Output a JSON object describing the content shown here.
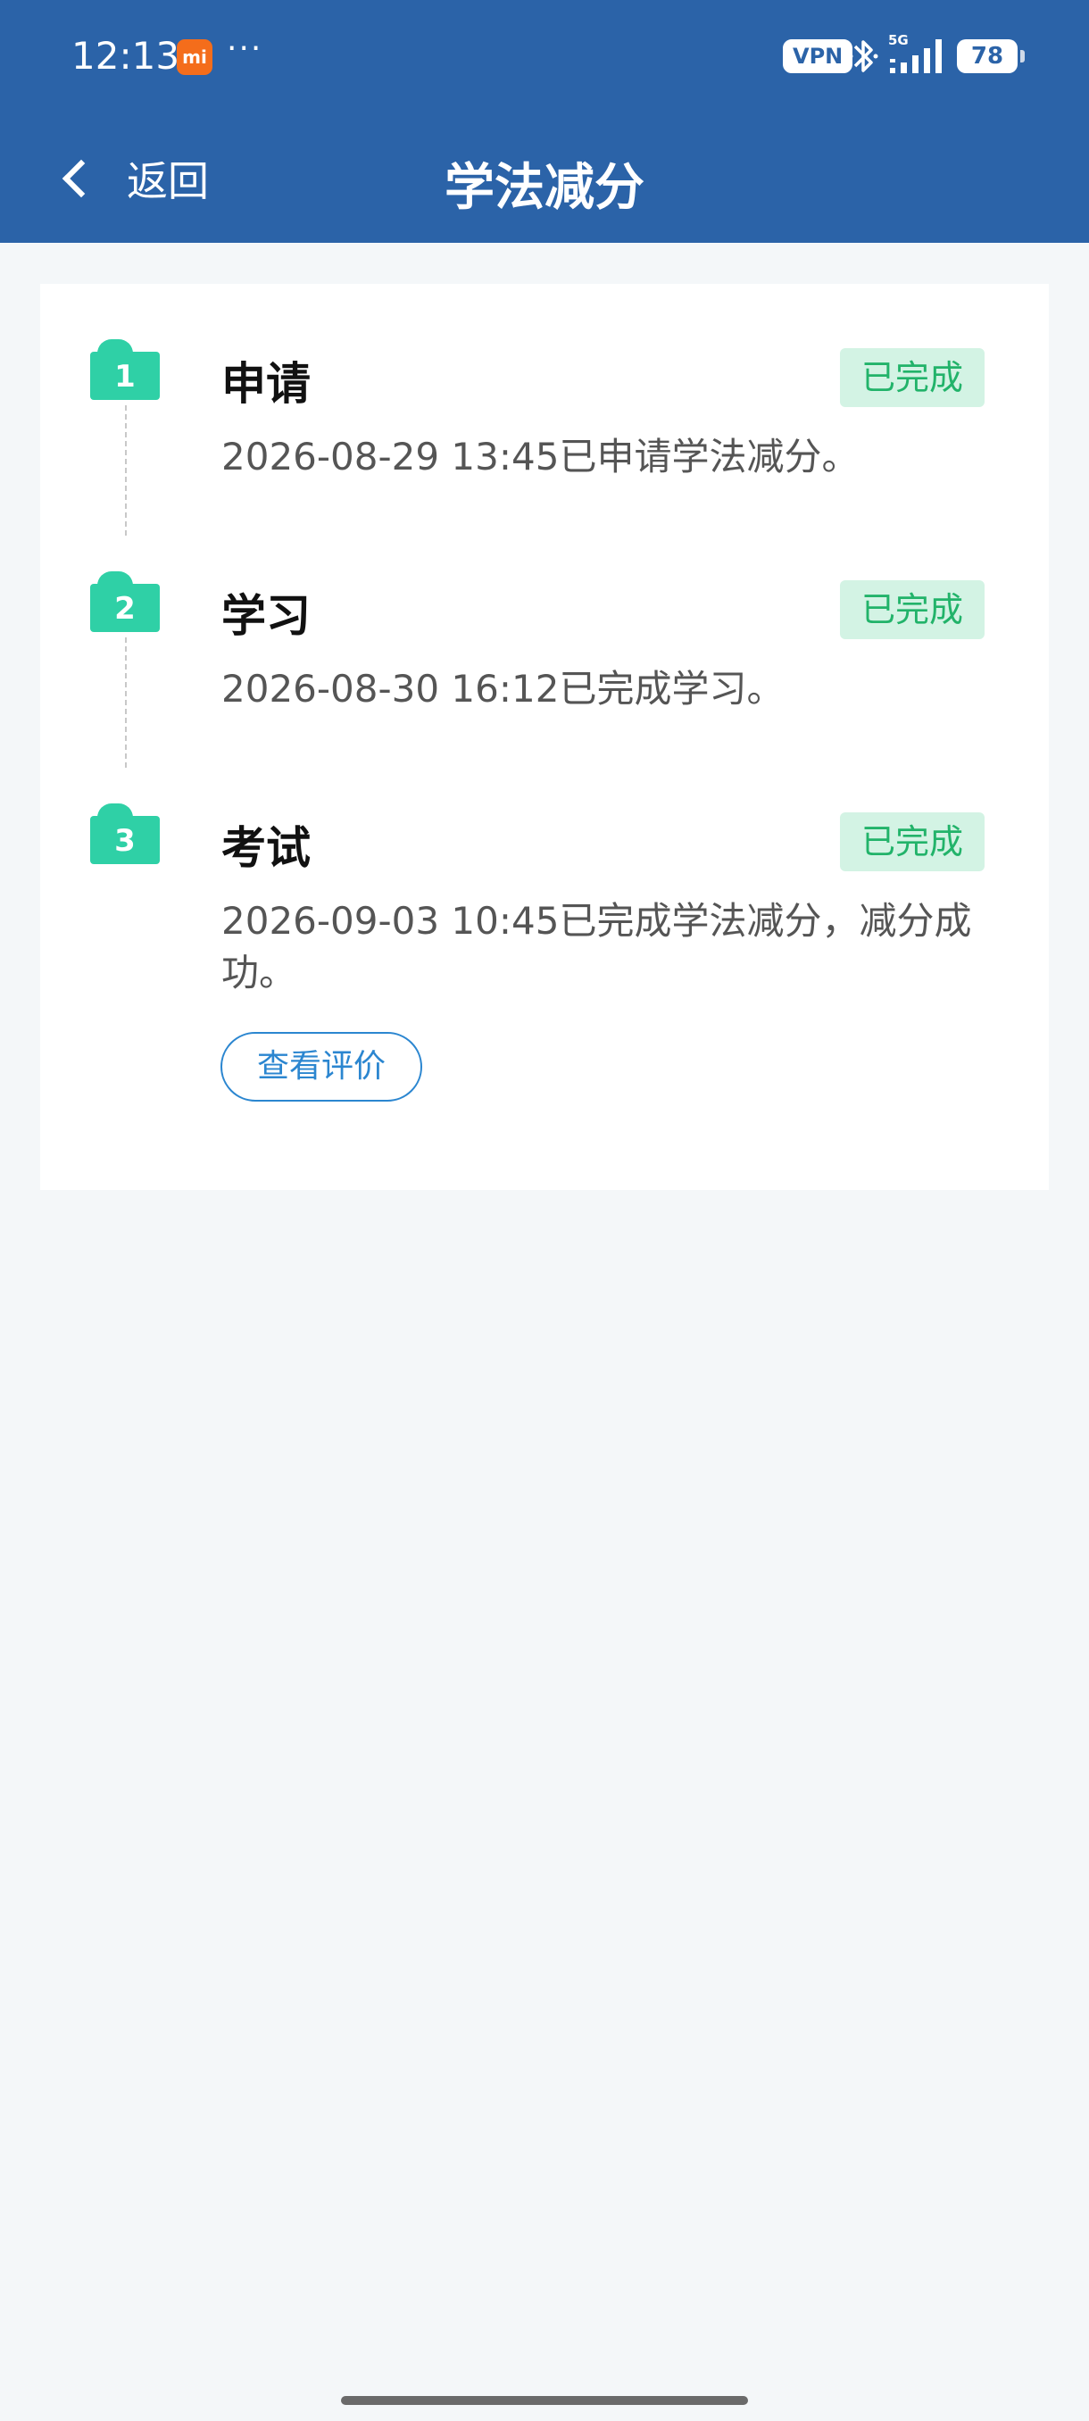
{
  "status_bar": {
    "time": "12:13",
    "mi_label": "mi",
    "more": "···",
    "vpn": "VPN",
    "network": "5G",
    "battery": "78"
  },
  "nav": {
    "back_label": "返回",
    "title": "学法减分"
  },
  "steps": [
    {
      "number": "1",
      "title": "申请",
      "status": "已完成",
      "description": "2026-08-29 13:45已申请学法减分。"
    },
    {
      "number": "2",
      "title": "学习",
      "status": "已完成",
      "description": "2026-08-30 16:12已完成学习。"
    },
    {
      "number": "3",
      "title": "考试",
      "status": "已完成",
      "description": "2026-09-03 10:45已完成学法减分，减分成功。",
      "action_label": "查看评价"
    }
  ],
  "colors": {
    "header": "#2b63a8",
    "step_badge": "#2fd0a6",
    "status_tag_bg": "#d3f3e4",
    "status_tag_text": "#22b36a",
    "link": "#2b86d0"
  }
}
